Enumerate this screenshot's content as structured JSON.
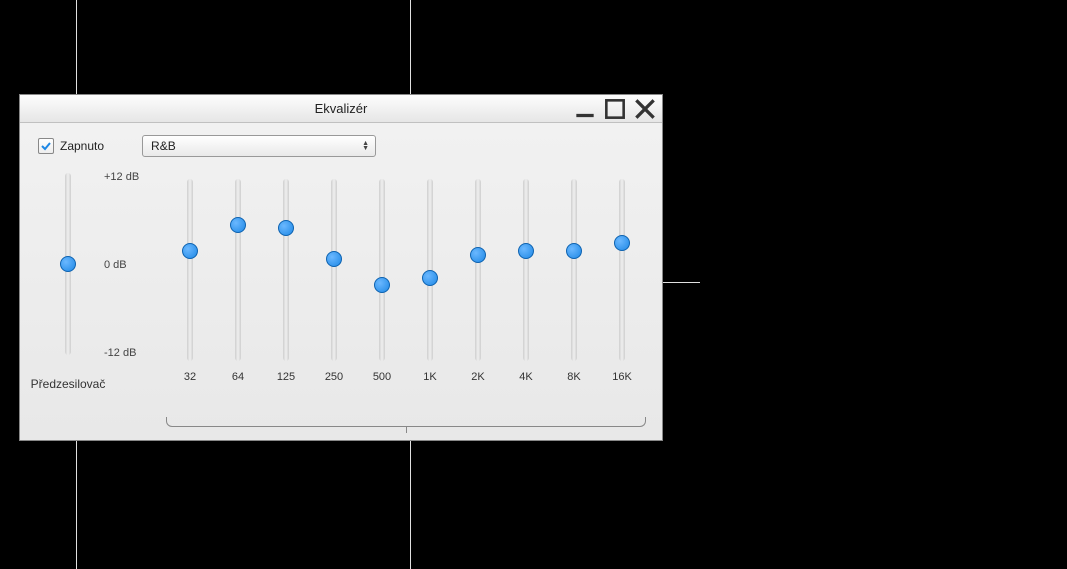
{
  "window": {
    "title": "Ekvalizér"
  },
  "controls": {
    "on_checkbox_label": "Zapnuto",
    "on_checked": true,
    "preset_selected": "R&B"
  },
  "scale": {
    "top": "+12 dB",
    "mid": "0 dB",
    "bottom": "-12 dB"
  },
  "preamp": {
    "label": "Předzesilovač",
    "value_db": 0
  },
  "bands": [
    {
      "freq": "32",
      "value_db": 2.5
    },
    {
      "freq": "64",
      "value_db": 6
    },
    {
      "freq": "125",
      "value_db": 5.5
    },
    {
      "freq": "250",
      "value_db": 1.5
    },
    {
      "freq": "500",
      "value_db": -2
    },
    {
      "freq": "1K",
      "value_db": -1
    },
    {
      "freq": "2K",
      "value_db": 2
    },
    {
      "freq": "4K",
      "value_db": 2.5
    },
    {
      "freq": "8K",
      "value_db": 2.5
    },
    {
      "freq": "16K",
      "value_db": 3.5
    }
  ],
  "slider_range": {
    "min": -12,
    "max": 12
  }
}
